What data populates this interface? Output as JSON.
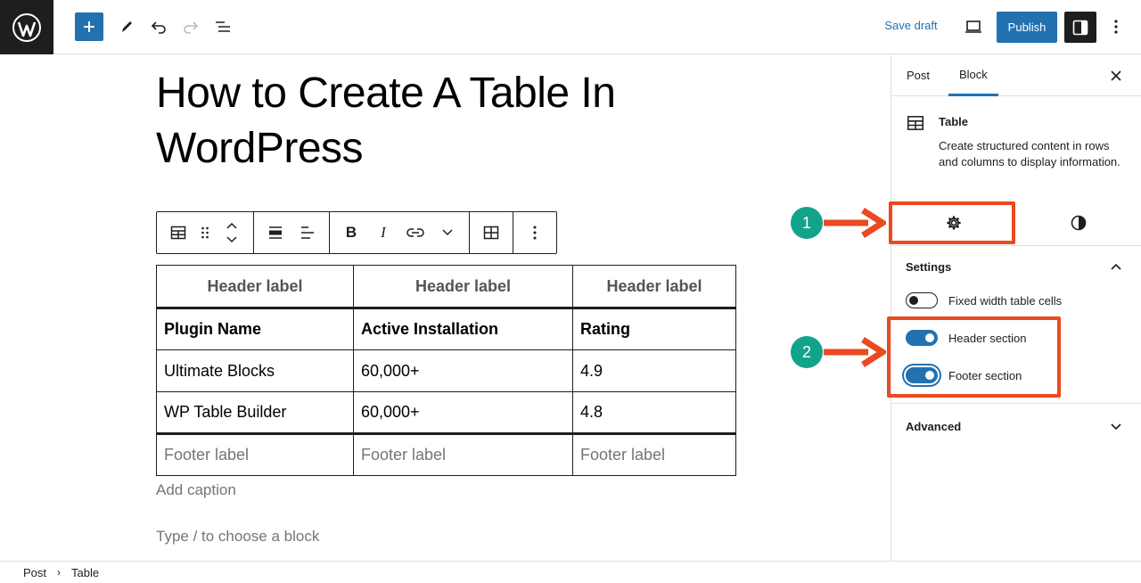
{
  "topbar": {
    "logo_icon": "wordpress-logo",
    "add_icon": "plus-icon",
    "tools_icon": "pencil-icon",
    "undo_icon": "undo-icon",
    "redo_icon": "redo-icon",
    "outline_icon": "list-view-icon",
    "save_draft": "Save draft",
    "preview_icon": "laptop-icon",
    "publish": "Publish",
    "settings_icon": "sidebar-icon",
    "more_icon": "vertical-ellipsis-icon"
  },
  "post": {
    "title": "How to Create A Table In WordPress"
  },
  "block_toolbar": {
    "icons": [
      "table-icon",
      "drag-handle-icon",
      "move-up-down-icon",
      "align-wide-icon",
      "align-left-icon",
      "bold-icon",
      "italic-icon",
      "link-icon",
      "chevron-down-icon",
      "edit-table-icon",
      "vertical-ellipsis-icon"
    ]
  },
  "table": {
    "header": [
      "Header label",
      "Header label",
      "Header label"
    ],
    "rows": [
      [
        "Plugin Name",
        "Active Installation",
        "Rating"
      ],
      [
        "Ultimate Blocks",
        "60,000+",
        "4.9"
      ],
      [
        "WP Table Builder",
        "60,000+",
        "4.8"
      ]
    ],
    "footer": [
      "Footer label",
      "Footer label",
      "Footer label"
    ],
    "caption_placeholder": "Add caption"
  },
  "appender_placeholder": "Type / to choose a block",
  "sidebar": {
    "tabs": [
      "Post",
      "Block"
    ],
    "active_tab": "Block",
    "close_icon": "close-icon",
    "block_card": {
      "icon": "table-icon",
      "title": "Table",
      "description": "Create structured content in rows and columns to display information."
    },
    "style_tabs": [
      "gear-icon",
      "contrast-icon"
    ],
    "settings_panel": {
      "title": "Settings",
      "toggles": [
        {
          "label": "Fixed width table cells",
          "checked": false
        },
        {
          "label": "Header section",
          "checked": true
        },
        {
          "label": "Footer section",
          "checked": true
        }
      ]
    },
    "advanced_panel": {
      "title": "Advanced"
    }
  },
  "annotations": {
    "markers": [
      "1",
      "2"
    ],
    "accent_color": "#ea4a1f",
    "marker_color": "#12a38a"
  },
  "breadcrumb": {
    "items": [
      "Post",
      "Table"
    ]
  },
  "colors": {
    "primary": "#2271b1",
    "dark": "#1e1e1e"
  }
}
